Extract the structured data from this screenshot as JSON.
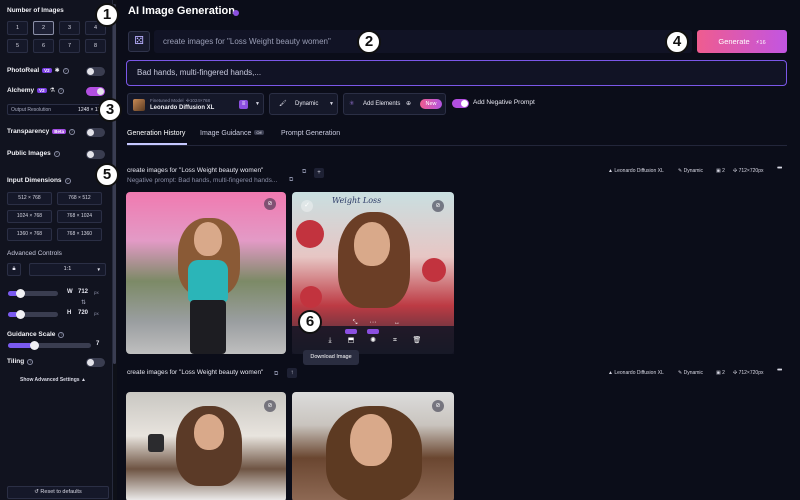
{
  "page": {
    "title": "AI Image Generation"
  },
  "sidebar": {
    "num_images": {
      "label": "Number of Images",
      "options": [
        "1",
        "2",
        "3",
        "4",
        "5",
        "6",
        "7",
        "8"
      ],
      "selected": "2"
    },
    "photoreal": {
      "label": "PhotoReal",
      "badge": "V2",
      "enabled": false
    },
    "alchemy": {
      "label": "Alchemy",
      "badge": "V2",
      "enabled": true
    },
    "output_resolution": {
      "label": "Output Resolution",
      "value": "1248 × 1320"
    },
    "transparency": {
      "label": "Transparency",
      "badge": "Beta",
      "enabled": false
    },
    "public_images": {
      "label": "Public Images",
      "enabled": false
    },
    "input_dimensions": {
      "label": "Input Dimensions",
      "options": [
        "512 × 768",
        "768 × 512",
        "1024 × 768",
        "768 × 1024",
        "1360 × 768",
        "768 × 1360"
      ]
    },
    "advanced_controls": {
      "label": "Advanced Controls",
      "aspect_ratio": "1:1",
      "width_label": "W",
      "width": "712",
      "height_label": "H",
      "height": "720",
      "unit": "px"
    },
    "guidance_scale": {
      "label": "Guidance Scale",
      "value": "7"
    },
    "tiling": {
      "label": "Tiling",
      "enabled": false
    },
    "show_advanced": "Show Advanced Settings",
    "reset": "Reset to defaults"
  },
  "prompt": {
    "placeholder": "create images for \"Loss Weight beauty women\"",
    "generate_label": "Generate",
    "cost": "16",
    "negative": "Bad hands, multi-fingered hands,..."
  },
  "options_bar": {
    "model_type": "Finetuned Model",
    "model_size": "1024×768",
    "model_name": "Leonardo Diffusion XL",
    "style": "Dynamic",
    "elements_label": "Add Elements",
    "new_badge": "New",
    "neg_prompt_label": "Add Negative Prompt"
  },
  "tabs": [
    {
      "label": "Generation History",
      "active": true
    },
    {
      "label": "Image Guidance",
      "badge": "Off"
    },
    {
      "label": "Prompt Generation"
    }
  ],
  "generations": [
    {
      "prompt": "create images for \"Loss Weight beauty women\"",
      "negative": "Negative prompt: Bad hands, multi-fingered hands...",
      "model": "Leonardo Diffusion XL",
      "style": "Dynamic",
      "count": "2",
      "size": "712×720px"
    },
    {
      "prompt": "create images for \"Loss Weight beauty women\"",
      "model": "Leonardo Diffusion XL",
      "style": "Dynamic",
      "count": "2",
      "size": "712×720px"
    }
  ],
  "image_overlay": {
    "tooltip": "Download Image",
    "caption": "Weight Loss"
  },
  "callouts": [
    "1",
    "2",
    "3",
    "4",
    "5",
    "6"
  ],
  "colors": {
    "accent": "#b24fe0",
    "generate_start": "#ef5c8f",
    "generate_end": "#c255e2",
    "background": "#0b0d19"
  }
}
